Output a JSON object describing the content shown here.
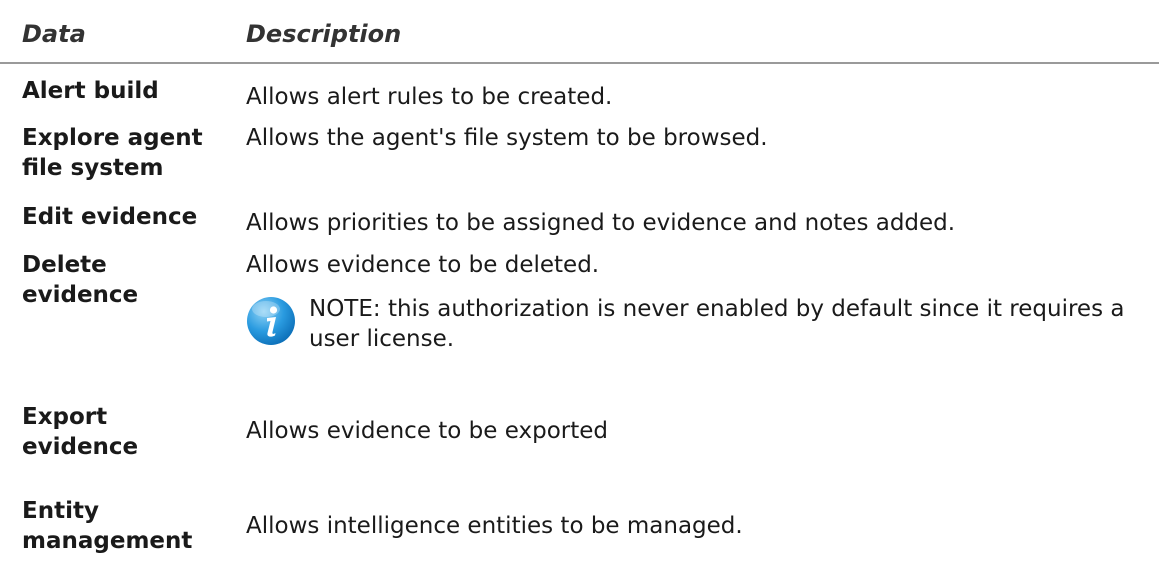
{
  "table": {
    "header": {
      "data": "Data",
      "description": "Description"
    },
    "rows": [
      {
        "term": "Alert build",
        "description": "Allows alert rules to be created."
      },
      {
        "term": "Explore  agent file system",
        "description": "Allows the agent's file system to be browsed."
      },
      {
        "term": "Edit evidence",
        "description": "Allows priorities to be assigned to evidence and notes added."
      },
      {
        "term": "Delete evidence",
        "description": "Allows evidence to be deleted."
      },
      {
        "term": "Export evidence",
        "description": "Allows evidence to be exported"
      },
      {
        "term": "Entity management",
        "description": "Allows intelligence entities to be managed."
      }
    ],
    "note": {
      "icon": "info-icon",
      "text": "NOTE: this authorization is never enabled by default since it requires a user license."
    }
  }
}
